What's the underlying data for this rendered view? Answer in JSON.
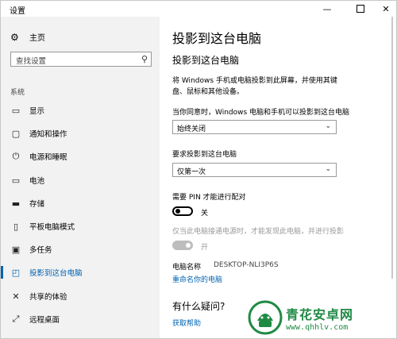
{
  "window": {
    "title": "设置",
    "min": "—",
    "close": "✕"
  },
  "sidebar": {
    "home_label": "主页",
    "search_placeholder": "查找设置",
    "section_label": "系统",
    "items": [
      {
        "label": "显示",
        "icon": "monitor-icon"
      },
      {
        "label": "通知和操作",
        "icon": "notification-icon"
      },
      {
        "label": "电源和睡眠",
        "icon": "power-icon"
      },
      {
        "label": "电池",
        "icon": "battery-icon"
      },
      {
        "label": "存储",
        "icon": "storage-icon"
      },
      {
        "label": "平板电脑模式",
        "icon": "tablet-icon"
      },
      {
        "label": "多任务",
        "icon": "multitask-icon"
      },
      {
        "label": "投影到这台电脑",
        "icon": "projector-icon",
        "active": true
      },
      {
        "label": "共享的体验",
        "icon": "share-icon"
      },
      {
        "label": "远程桌面",
        "icon": "remote-icon"
      }
    ]
  },
  "main": {
    "page_title": "投影到这台电脑",
    "subtitle": "投影到这台电脑",
    "description": "将 Windows 手机或电脑投影到此屏幕，并使用其键盘、鼠标和其他设备。",
    "when_label": "当你同意时，Windows 电脑和手机可以投影到这台电脑",
    "when_value": "始终关闭",
    "request_label": "要求投影到这台电脑",
    "request_value": "仅第一次",
    "pin_label": "需要 PIN 才能进行配对",
    "pin_state": "关",
    "power_label": "仅当此电脑接通电源时，才能发现此电脑，并进行投影",
    "power_state": "开",
    "pc_name_label": "电脑名称",
    "pc_name_value": "DESKTOP-NLI3P6S",
    "rename_link": "重命名你的电脑",
    "question_heading": "有什么疑问?",
    "help_link": "获取帮助"
  },
  "watermark": {
    "name": "青花安卓网",
    "url": "www.qhhlv.com"
  },
  "colors": {
    "accent": "#0063b1",
    "sidebar_bg": "#f2f2f2",
    "watermark": "#1f8a44"
  }
}
